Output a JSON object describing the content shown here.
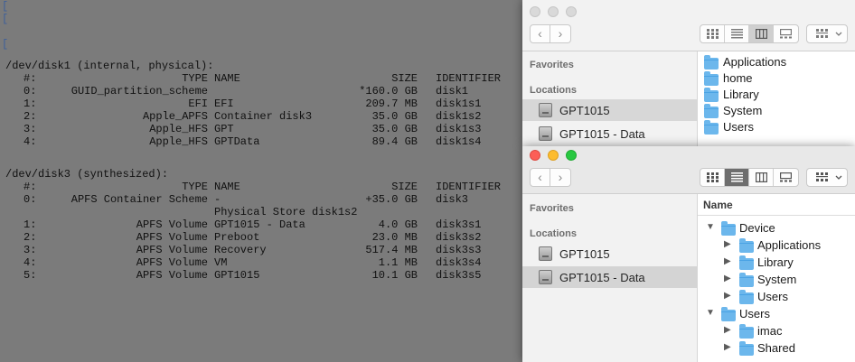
{
  "terminal": {
    "left_marks": [
      "[",
      "[",
      "",
      "["
    ],
    "disk1_header": "/dev/disk1 (internal, physical):",
    "disk1_rows": [
      {
        "num": "#:",
        "type": "TYPE",
        "name": "NAME",
        "size": "SIZE",
        "id": "IDENTIFIER"
      },
      {
        "num": "0:",
        "type": "GUID_partition_scheme",
        "name": "",
        "size": "*160.0 GB",
        "id": "disk1"
      },
      {
        "num": "1:",
        "type": "EFI",
        "name": "EFI",
        "size": "209.7 MB",
        "id": "disk1s1"
      },
      {
        "num": "2:",
        "type": "Apple_APFS",
        "name": "Container disk3",
        "size": "35.0 GB",
        "id": "disk1s2"
      },
      {
        "num": "3:",
        "type": "Apple_HFS",
        "name": "GPT",
        "size": "35.0 GB",
        "id": "disk1s3"
      },
      {
        "num": "4:",
        "type": "Apple_HFS",
        "name": "GPTData",
        "size": "89.4 GB",
        "id": "disk1s4"
      }
    ],
    "disk3_header": "/dev/disk3 (synthesized):",
    "disk3_rows": [
      {
        "num": "#:",
        "type": "TYPE",
        "name": "NAME",
        "size": "SIZE",
        "id": "IDENTIFIER"
      },
      {
        "num": "0:",
        "type": "APFS Container Scheme",
        "name": "-",
        "size": "+35.0 GB",
        "id": "disk3"
      },
      {
        "num": "",
        "type": "",
        "name": "Physical Store disk1s2",
        "size": "",
        "id": ""
      },
      {
        "num": "1:",
        "type": "APFS Volume",
        "name": "GPT1015 - Data",
        "size": "4.0 GB",
        "id": "disk3s1"
      },
      {
        "num": "2:",
        "type": "APFS Volume",
        "name": "Preboot",
        "size": "23.0 MB",
        "id": "disk3s2"
      },
      {
        "num": "3:",
        "type": "APFS Volume",
        "name": "Recovery",
        "size": "517.4 MB",
        "id": "disk3s3"
      },
      {
        "num": "4:",
        "type": "APFS Volume",
        "name": "VM",
        "size": "1.1 MB",
        "id": "disk3s4"
      },
      {
        "num": "5:",
        "type": "APFS Volume",
        "name": "GPT1015",
        "size": "10.1 GB",
        "id": "disk3s5"
      }
    ]
  },
  "finder_back": {
    "sidebar": {
      "favorites_label": "Favorites",
      "locations_label": "Locations",
      "items": [
        {
          "label": "GPT1015",
          "selected": true
        },
        {
          "label": "GPT1015 - Data",
          "selected": false
        }
      ]
    },
    "files": [
      "Applications",
      "home",
      "Library",
      "System",
      "Users"
    ]
  },
  "finder_front": {
    "sidebar": {
      "favorites_label": "Favorites",
      "locations_label": "Locations",
      "items": [
        {
          "label": "GPT1015",
          "selected": false
        },
        {
          "label": "GPT1015 - Data",
          "selected": true
        }
      ]
    },
    "column_header": "Name",
    "tree": [
      {
        "label": "Device",
        "level": 0,
        "expanded": true
      },
      {
        "label": "Applications",
        "level": 1,
        "expanded": false
      },
      {
        "label": "Library",
        "level": 1,
        "expanded": false
      },
      {
        "label": "System",
        "level": 1,
        "expanded": false
      },
      {
        "label": "Users",
        "level": 1,
        "expanded": false
      },
      {
        "label": "Users",
        "level": 0,
        "expanded": true
      },
      {
        "label": "imac",
        "level": 1,
        "expanded": false
      },
      {
        "label": "Shared",
        "level": 1,
        "expanded": false
      }
    ]
  },
  "icons": {
    "back": "chevron-left-icon",
    "forward": "chevron-right-icon",
    "icon_view": "grid-view-icon",
    "list_view": "list-view-icon",
    "column_view": "column-view-icon",
    "gallery_view": "gallery-view-icon",
    "group": "group-by-icon",
    "disk": "hard-disk-icon",
    "folder": "folder-icon"
  },
  "colors": {
    "folder": "#6cb7ec",
    "close": "#fc5f57",
    "minimize": "#fdbc2e",
    "zoom": "#28c841",
    "terminal_bg": "#7b7b7b"
  }
}
